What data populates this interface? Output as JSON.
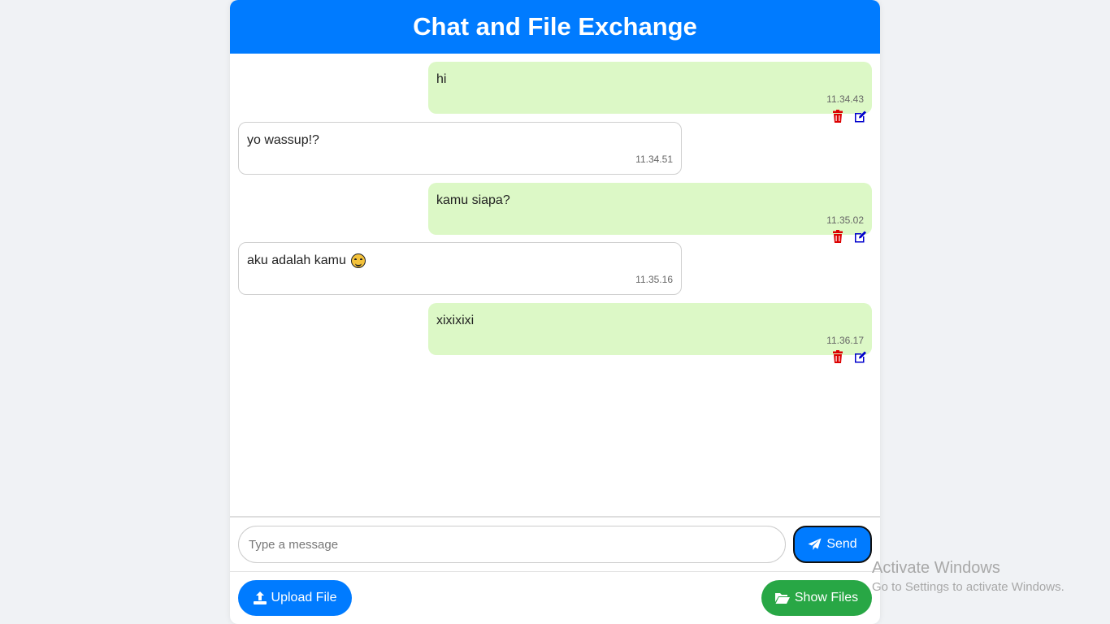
{
  "header": {
    "title": "Chat and File Exchange"
  },
  "messages": [
    {
      "type": "sent",
      "text": "hi",
      "time": "11.34.43"
    },
    {
      "type": "received",
      "text": "yo wassup!?",
      "time": "11.34.51"
    },
    {
      "type": "sent",
      "text": "kamu siapa?",
      "time": "11.35.02"
    },
    {
      "type": "received",
      "text": "aku adalah kamu",
      "emoji": "smiling-face-emoji",
      "time": "11.35.16"
    },
    {
      "type": "sent",
      "text": "xixixixi",
      "time": "11.36.17"
    }
  ],
  "composer": {
    "placeholder": "Type a message",
    "send_label": "Send"
  },
  "footer": {
    "upload_label": "Upload File",
    "show_files_label": "Show Files"
  },
  "watermark": {
    "title": "Activate Windows",
    "subtitle": "Go to Settings to activate Windows."
  },
  "colors": {
    "primary": "#007bff",
    "success": "#28a745",
    "sent_bubble": "#dcf8c6",
    "delete_icon": "#dc0000",
    "edit_icon": "#0000cc"
  },
  "icons": {
    "delete": "trash-icon",
    "edit": "edit-icon",
    "send": "paper-plane-icon",
    "upload": "upload-icon",
    "show_files": "folder-open-icon"
  }
}
